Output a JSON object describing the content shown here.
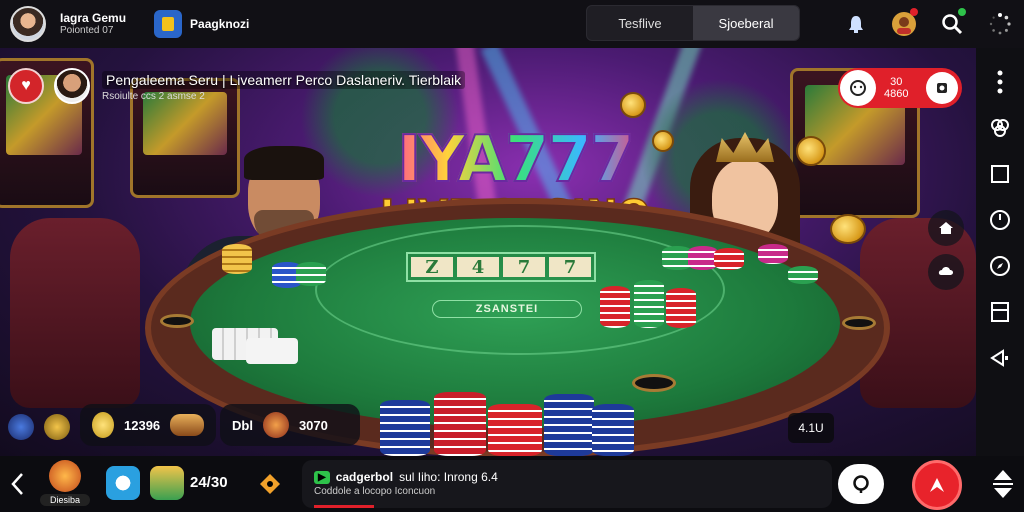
{
  "header": {
    "user_name": "Iagra Gemu",
    "user_subtitle": "Poionted 07",
    "page_label": "Paagknozi",
    "tabs": [
      {
        "label": "Tesflive",
        "active": false
      },
      {
        "label": "Sjoeberal",
        "active": true
      }
    ],
    "icons": [
      "bell-icon",
      "profile-icon",
      "search-icon",
      "loading-icon"
    ]
  },
  "stream": {
    "title": "Pengaleema Seru | Liveamerr Perco Daslaneriv. Tierblaik",
    "subtitle": "Rsoiulte ccs 2 asmse 2",
    "viewer_count_top": "30",
    "viewer_count_bottom": "4860"
  },
  "scene": {
    "logo_line1": "IYA777",
    "logo_line2": "LIVE CASINO",
    "felt_digits": [
      "Z",
      "4",
      "7",
      "7"
    ],
    "felt_text": "ZSANSTEI"
  },
  "stats": {
    "balance": "12396",
    "label": "Dbl",
    "bet": "3070",
    "mini_label": "4.1U"
  },
  "bottom": {
    "game_label": "Diesiba",
    "count": "24/30",
    "news_title": "cadgerbol",
    "news_title_rest": "sul Iiho: Inrong 6.4",
    "news_sub": "Coddole a locopo Iconcuon"
  },
  "colors": {
    "accent_red": "#e0202a",
    "felt_green": "#1d7a3c",
    "gold": "#ffcc33"
  }
}
